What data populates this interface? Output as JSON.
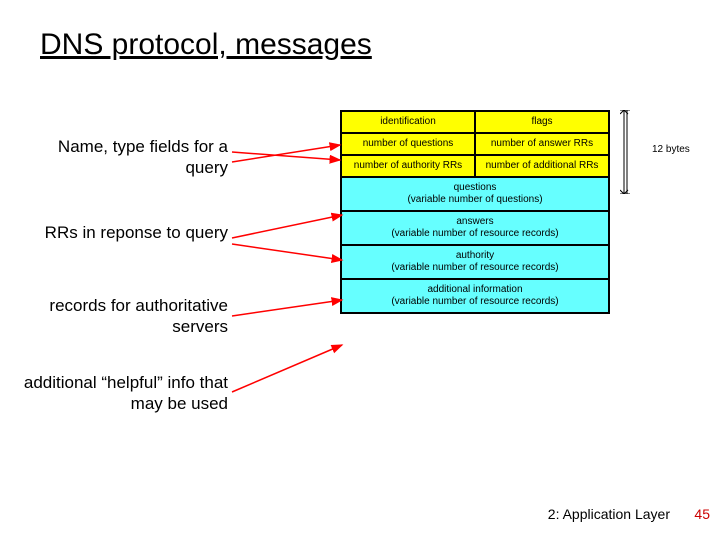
{
  "title": "DNS protocol, messages",
  "labels": {
    "name_type": "Name, type fields for a query",
    "rrs": "RRs in reponse to query",
    "records": "records for authoritative servers",
    "additional": "additional “helpful” info that may be used"
  },
  "header_rows": [
    [
      "identification",
      "flags"
    ],
    [
      "number of questions",
      "number of answer RRs"
    ],
    [
      "number of authority RRs",
      "number of additional RRs"
    ]
  ],
  "body_rows": [
    "questions\n(variable number of questions)",
    "answers\n(variable number of resource records)",
    "authority\n(variable number of resource records)",
    "additional information\n(variable number of resource records)"
  ],
  "bytes_label": "12 bytes",
  "footer": "2: Application Layer",
  "page_num": "45",
  "colors": {
    "header": "#ffff00",
    "body": "#66ffff",
    "arrow": "#ff0000"
  }
}
